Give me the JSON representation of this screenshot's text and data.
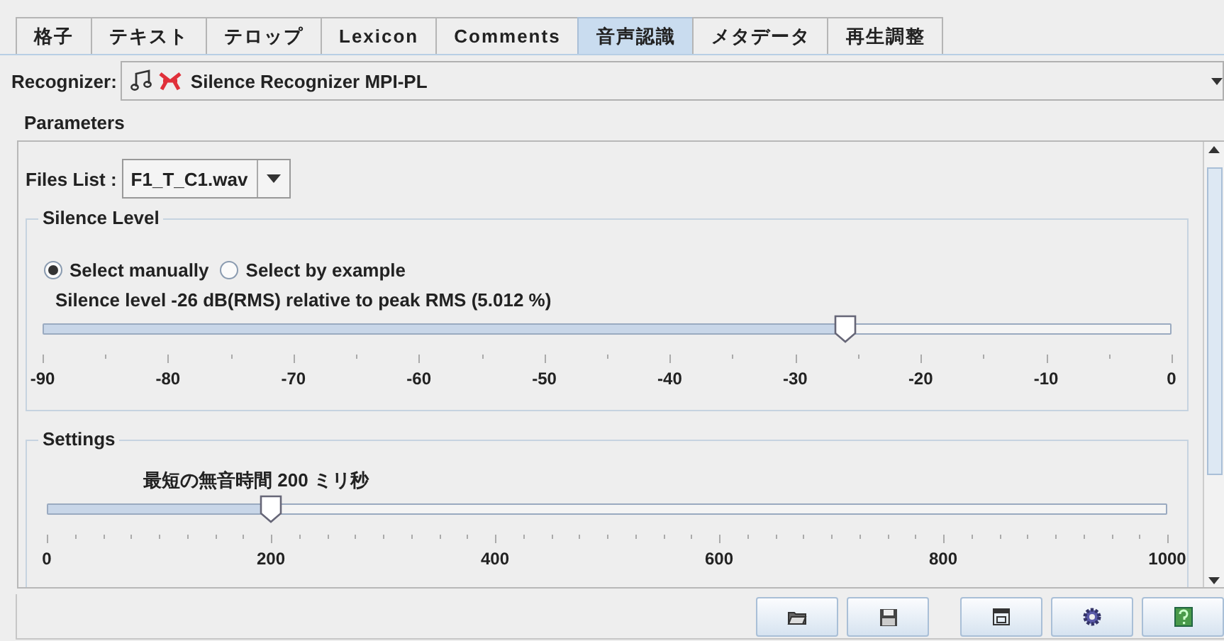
{
  "tabs": [
    {
      "label": "格子",
      "selected": false
    },
    {
      "label": "テキスト",
      "selected": false
    },
    {
      "label": "テロップ",
      "selected": false
    },
    {
      "label": "Lexicon",
      "selected": false
    },
    {
      "label": "Comments",
      "selected": false
    },
    {
      "label": "音声認識",
      "selected": true
    },
    {
      "label": "メタデータ",
      "selected": false
    },
    {
      "label": "再生調整",
      "selected": false
    }
  ],
  "recognizer": {
    "label": "Recognizer:",
    "value": "Silence Recognizer MPI-PL"
  },
  "parameters": {
    "title": "Parameters",
    "files_list": {
      "label": "Files List :",
      "value": "F1_T_C1.wav"
    },
    "silence_level": {
      "title": "Silence Level",
      "options": [
        {
          "label": "Select manually",
          "selected": true
        },
        {
          "label": "Select by example",
          "selected": false
        }
      ],
      "slider": {
        "caption": "Silence level -26 dB(RMS) relative to peak RMS (5.012 %)",
        "level": 0.711,
        "tick_labels": [
          "-90",
          "-80",
          "-70",
          "-60",
          "-50",
          "-40",
          "-30",
          "-20",
          "-10",
          "0"
        ]
      }
    },
    "settings": {
      "title": "Settings",
      "slider": {
        "caption": "最短の無音時間 200 ミリ秒",
        "level": 0.2,
        "tick_labels": [
          "0",
          "200",
          "400",
          "600",
          "800",
          "1000"
        ]
      }
    }
  },
  "toolbar_buttons": [
    {
      "kind": "open"
    },
    {
      "kind": "save"
    },
    {
      "kind": "window"
    },
    {
      "kind": "settings"
    },
    {
      "kind": "help"
    }
  ]
}
